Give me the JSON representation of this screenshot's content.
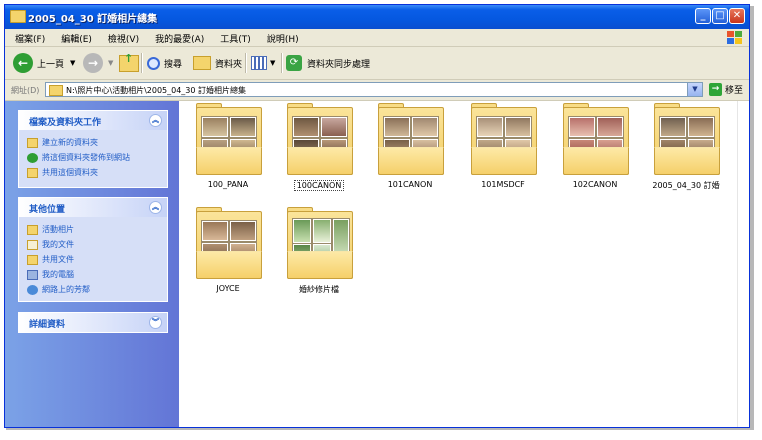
{
  "window": {
    "title": "2005_04_30 訂婚相片總集",
    "buttons": {
      "minimize": "_",
      "maximize": "□",
      "close": "✕"
    }
  },
  "menu": [
    "檔案(F)",
    "編輯(E)",
    "檢視(V)",
    "我的最愛(A)",
    "工具(T)",
    "說明(H)"
  ],
  "toolbar": {
    "back_label": "上一頁",
    "search_label": "搜尋",
    "folders_label": "資料夾",
    "sync_label": "資料夾同步處理"
  },
  "address": {
    "label": "網址(D)",
    "value": "N:\\照片中心\\活動相片\\2005_04_30 訂婚相片總集",
    "go_label": "移至"
  },
  "tasks": {
    "title": "檔案及資料夾工作",
    "items": [
      "建立新的資料夾",
      "將這個資料夾發佈到網站",
      "共用這個資料夾"
    ]
  },
  "other_places": {
    "title": "其他位置",
    "items": [
      "活動相片",
      "我的文件",
      "共用文件",
      "我的電腦",
      "網路上的芳鄰"
    ]
  },
  "details": {
    "title": "詳細資料"
  },
  "folders": [
    {
      "name": "100_PANA",
      "selected": false
    },
    {
      "name": "100CANON",
      "selected": true
    },
    {
      "name": "101CANON",
      "selected": false
    },
    {
      "name": "101MSDCF",
      "selected": false
    },
    {
      "name": "102CANON",
      "selected": false
    },
    {
      "name": "2005_04_30 訂婚",
      "selected": false
    },
    {
      "name": "JOYCE",
      "selected": false
    },
    {
      "name": "婚紗修片檔",
      "selected": false
    }
  ],
  "colors": {
    "titlebar": "#0558e0",
    "taskpane": "#6375d6",
    "link": "#215dc6",
    "folder": "#f4d46c"
  }
}
